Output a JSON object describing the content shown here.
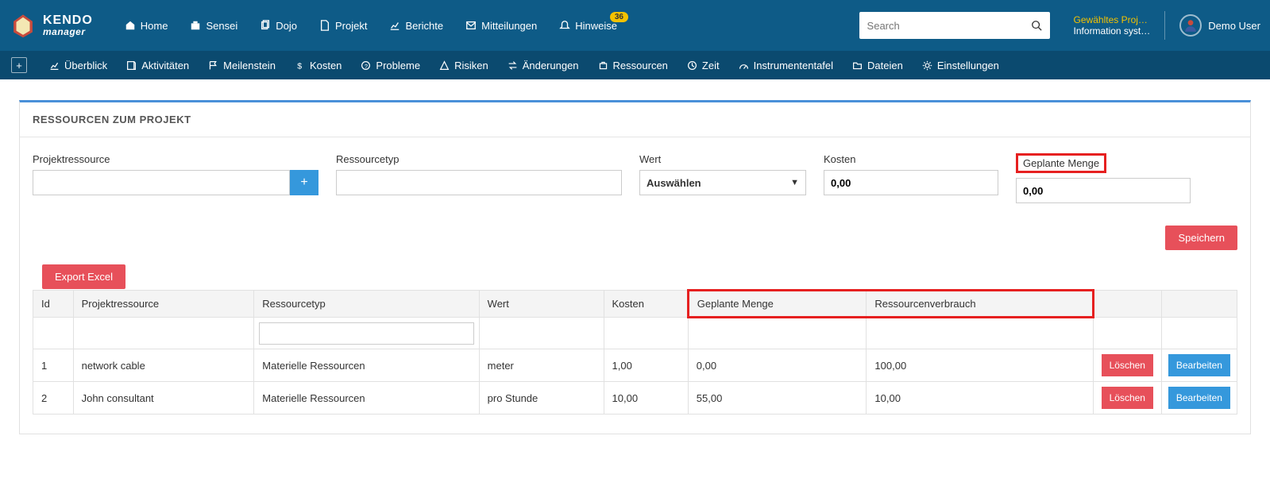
{
  "logo": {
    "line1": "KENDO",
    "line2": "manager"
  },
  "nav": {
    "home": "Home",
    "sensei": "Sensei",
    "dojo": "Dojo",
    "projekt": "Projekt",
    "berichte": "Berichte",
    "mitteilungen": "Mitteilungen",
    "hinweise": "Hinweise",
    "hinweise_badge": "36"
  },
  "search": {
    "placeholder": "Search"
  },
  "top_right": {
    "project_line1": "Gewähltes Proj…",
    "project_line2": "Information syst…",
    "user_name": "Demo User"
  },
  "subnav": {
    "uberblick": "Überblick",
    "aktivitaten": "Aktivitäten",
    "meilenstein": "Meilenstein",
    "kosten": "Kosten",
    "probleme": "Probleme",
    "risiken": "Risiken",
    "anderungen": "Änderungen",
    "ressourcen": "Ressourcen",
    "zeit": "Zeit",
    "instrumententafel": "Instrumententafel",
    "dateien": "Dateien",
    "einstellungen": "Einstellungen"
  },
  "panel": {
    "title": "RESSOURCEN ZUM PROJEKT"
  },
  "form": {
    "projektressource_label": "Projektressource",
    "ressourcetyp_label": "Ressourcetyp",
    "wert_label": "Wert",
    "wert_select": "Auswählen",
    "kosten_label": "Kosten",
    "kosten_value": "0,00",
    "geplante_menge_label": "Geplante Menge",
    "geplante_menge_value": "0,00"
  },
  "buttons": {
    "speichern": "Speichern",
    "export_excel": "Export Excel",
    "loeschen": "Löschen",
    "bearbeiten": "Bearbeiten"
  },
  "table": {
    "headers": {
      "id": "Id",
      "projektressource": "Projektressource",
      "ressourcetyp": "Ressourcetyp",
      "wert": "Wert",
      "kosten": "Kosten",
      "geplante_menge": "Geplante Menge",
      "ressourcenverbrauch": "Ressourcenverbrauch"
    },
    "rows": [
      {
        "id": "1",
        "projektressource": "network cable",
        "ressourcetyp": "Materielle Ressourcen",
        "wert": "meter",
        "kosten": "1,00",
        "geplante": "0,00",
        "verbrauch": "100,00"
      },
      {
        "id": "2",
        "projektressource": "John consultant",
        "ressourcetyp": "Materielle Ressourcen",
        "wert": "pro Stunde",
        "kosten": "10,00",
        "geplante": "55,00",
        "verbrauch": "10,00"
      }
    ]
  }
}
